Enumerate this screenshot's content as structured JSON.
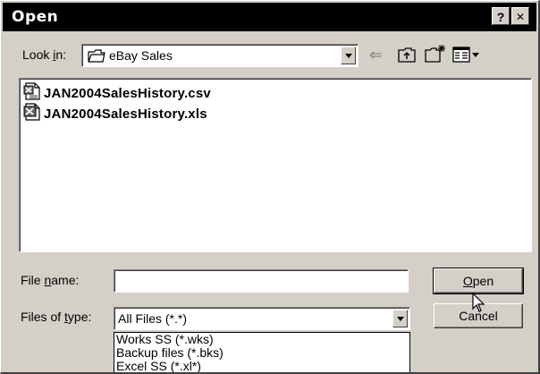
{
  "window": {
    "title": "Open",
    "help_label": "?",
    "close_label": "✕"
  },
  "toolbar": {
    "look_in_prefix": "Look ",
    "look_in_accel": "i",
    "look_in_suffix": "n:",
    "look_in_value": "eBay Sales",
    "back_glyph": "⇐"
  },
  "files": [
    {
      "name": "JAN2004SalesHistory.csv",
      "icon": "csv-file-icon"
    },
    {
      "name": "JAN2004SalesHistory.xls",
      "icon": "excel-file-icon"
    }
  ],
  "file_name": {
    "label_prefix": "File ",
    "label_accel": "n",
    "label_suffix": "ame:",
    "value": ""
  },
  "file_type": {
    "label_prefix": "Files of ",
    "label_accel": "t",
    "label_suffix": "ype:",
    "value": "All Files (*.*)",
    "options": [
      "Works SS (*.wks)",
      "Backup files (*.bks)",
      "Excel SS (*.xl*)"
    ]
  },
  "buttons": {
    "open_accel": "O",
    "open_rest": "pen",
    "cancel_label": "Cancel"
  }
}
